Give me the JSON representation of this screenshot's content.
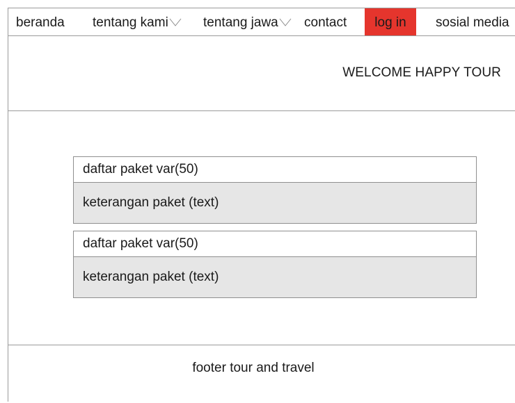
{
  "nav": {
    "items": [
      {
        "label": "beranda",
        "dropdown": false
      },
      {
        "label": "tentang kami",
        "dropdown": true
      },
      {
        "label": "tentang jawa",
        "dropdown": true
      },
      {
        "label": "contact",
        "dropdown": false
      },
      {
        "label": "log in",
        "dropdown": false,
        "highlight": "#e5352d"
      },
      {
        "label": "sosial media",
        "dropdown": false
      }
    ],
    "dropdown_icon": "chevron-down-icon"
  },
  "hero": {
    "title": "WELCOME HAPPY TOUR"
  },
  "packages": [
    {
      "title": "daftar paket var(50)",
      "description": "keterangan paket (text)"
    },
    {
      "title": "daftar paket var(50)",
      "description": "keterangan paket (text)"
    }
  ],
  "footer": {
    "text": "footer tour and travel"
  },
  "colors": {
    "accent": "#e5352d",
    "description_background": "#e6e6e6",
    "border": "#9a9a9a"
  }
}
